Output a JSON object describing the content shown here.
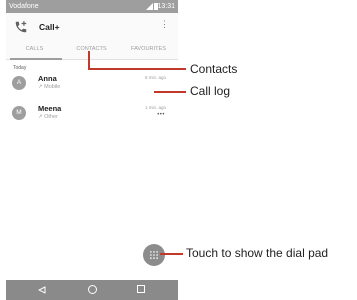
{
  "status_bar": {
    "carrier": "Vodafone",
    "time": "13:31"
  },
  "app_bar": {
    "title": "Call+"
  },
  "tabs": [
    {
      "label": "CALLS"
    },
    {
      "label": "CONTACTS"
    },
    {
      "label": "FAVOURITES"
    }
  ],
  "section_label": "Today",
  "call_log": [
    {
      "initial": "A",
      "name": "Anna",
      "type": "Mobile",
      "time": "8 min. ago"
    },
    {
      "initial": "M",
      "name": "Meena",
      "type": "Other",
      "time": "1 min. ago"
    }
  ],
  "annotations": {
    "contacts": "Contacts",
    "call_log": "Call log",
    "dial_pad": "Touch to show the dial pad"
  },
  "colors": {
    "annotation_line": "#c0392b",
    "status_bar": "#9e9e9e",
    "nav_bar": "#8a8a8a"
  },
  "icons": {
    "app": "phone-add-icon",
    "fab": "dialpad-icon"
  }
}
